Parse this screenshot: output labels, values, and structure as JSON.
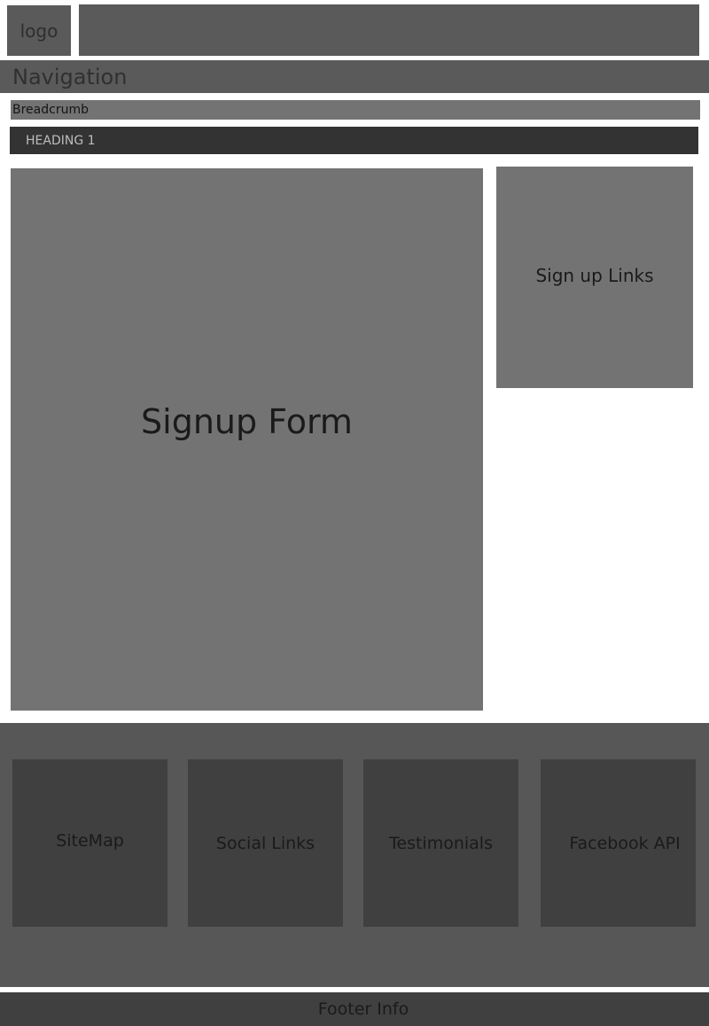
{
  "header": {
    "logo": "logo"
  },
  "navigation": {
    "label": "Navigation"
  },
  "breadcrumb": {
    "label": "Breadcrumb"
  },
  "heading": {
    "label": "HEADING 1"
  },
  "main": {
    "signup_form": "Signup Form",
    "signup_links": "Sign up Links"
  },
  "footer": {
    "tiles": [
      "SiteMap",
      "Social Links",
      "Testimonials",
      "Facebook API"
    ],
    "info": "Footer Info"
  },
  "colors": {
    "block": "#5a5a5a",
    "content": "#737373",
    "dark": "#333333",
    "footer": "#575757",
    "tile": "#404040"
  }
}
